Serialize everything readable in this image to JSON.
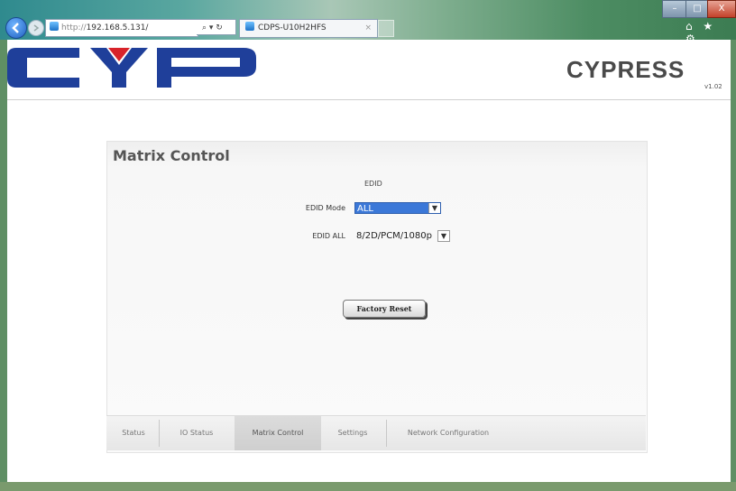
{
  "browser": {
    "address_protocol": "http://",
    "address_host": "192.168.5.131/",
    "address_tools": "⌕ ▾ ↻",
    "tab_title": "CDPS-U10H2HFS",
    "tab_close": "×",
    "minimize_glyph": "–",
    "maximize_glyph": "□",
    "close_glyph": "X",
    "toolbar_icons": "⌂ ★ ⚙"
  },
  "header": {
    "brand": "CYPRESS",
    "version": "v1.02",
    "logo_colors": {
      "blue": "#1f3f9a",
      "red": "#d8232a"
    }
  },
  "panel": {
    "title": "Matrix Control",
    "section": "EDID",
    "edid_mode_label": "EDID Mode",
    "edid_mode_value": "ALL",
    "edid_all_label": "EDID ALL",
    "edid_all_value": "8/2D/PCM/1080p",
    "factory_reset_label": "Factory Reset"
  },
  "nav": {
    "items": [
      {
        "label": "Status"
      },
      {
        "label": "IO Status"
      },
      {
        "label": "Matrix Control"
      },
      {
        "label": "Settings"
      },
      {
        "label": "Network Configuration"
      }
    ],
    "active": "Matrix Control"
  }
}
